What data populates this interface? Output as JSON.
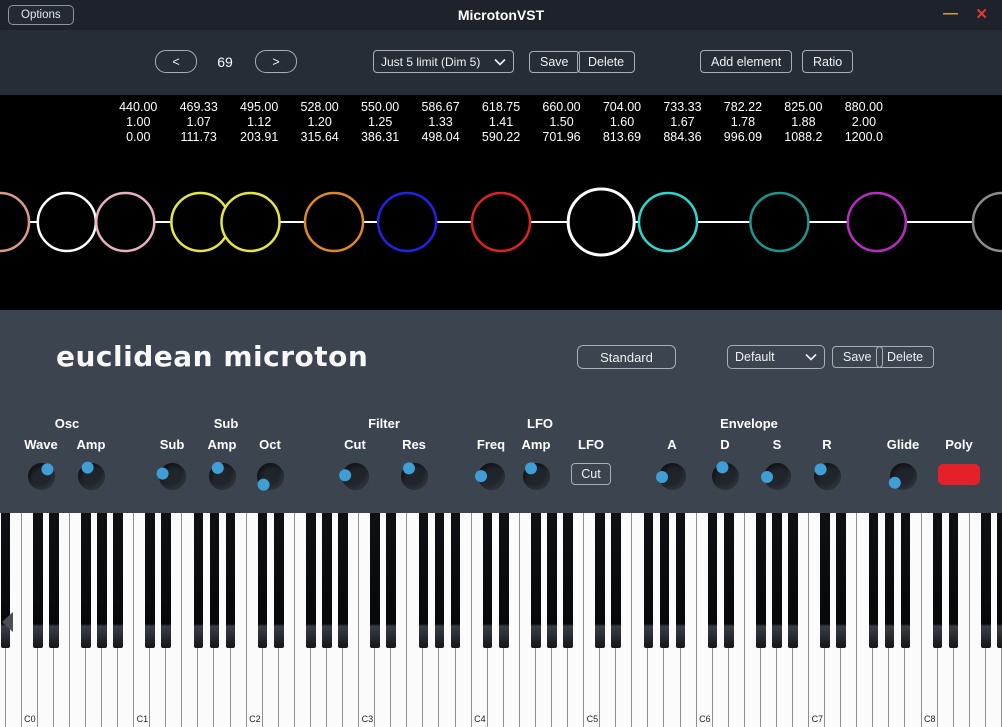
{
  "titlebar": {
    "options_label": "Options",
    "title": "MicrotonVST",
    "minimize_glyph": "—",
    "close_glyph": "✕"
  },
  "toolbar": {
    "prev_label": "<",
    "scale_number": "69",
    "next_label": ">",
    "scale_select_value": "Just 5 limit (Dim 5)",
    "save_label": "Save",
    "delete_label": "Delete",
    "add_element_label": "Add element",
    "ratio_label": "Ratio"
  },
  "scale_display": {
    "line_color": "#ffffff",
    "notes": [
      {
        "freq": "440.00",
        "ratio": "1.00",
        "cents": "0.00",
        "ratio_value": 1.0,
        "color": "#d99a8c",
        "selected": false
      },
      {
        "freq": "469.33",
        "ratio": "1.07",
        "cents": "111.73",
        "ratio_value": 1.0667,
        "color": "#ffffff",
        "selected": false
      },
      {
        "freq": "495.00",
        "ratio": "1.12",
        "cents": "203.91",
        "ratio_value": 1.125,
        "color": "#e8b0bc",
        "selected": false
      },
      {
        "freq": "528.00",
        "ratio": "1.20",
        "cents": "315.64",
        "ratio_value": 1.2,
        "color": "#e6e642",
        "selected": false
      },
      {
        "freq": "550.00",
        "ratio": "1.25",
        "cents": "386.31",
        "ratio_value": 1.25,
        "color": "#e6e642",
        "selected": false
      },
      {
        "freq": "586.67",
        "ratio": "1.33",
        "cents": "498.04",
        "ratio_value": 1.3333,
        "color": "#e08828",
        "selected": false
      },
      {
        "freq": "618.75",
        "ratio": "1.41",
        "cents": "590.22",
        "ratio_value": 1.4063,
        "color": "#2222e8",
        "selected": false
      },
      {
        "freq": "660.00",
        "ratio": "1.50",
        "cents": "701.96",
        "ratio_value": 1.5,
        "color": "#dd2222",
        "selected": false
      },
      {
        "freq": "704.00",
        "ratio": "1.60",
        "cents": "813.69",
        "ratio_value": 1.6,
        "color": "#ffffff",
        "selected": true
      },
      {
        "freq": "733.33",
        "ratio": "1.67",
        "cents": "884.36",
        "ratio_value": 1.6667,
        "color": "#2cd8d0",
        "selected": false
      },
      {
        "freq": "782.22",
        "ratio": "1.78",
        "cents": "996.09",
        "ratio_value": 1.7778,
        "color": "#1e948e",
        "selected": false
      },
      {
        "freq": "825.00",
        "ratio": "1.88",
        "cents": "1088.2",
        "ratio_value": 1.875,
        "color": "#b82cc4",
        "selected": false
      },
      {
        "freq": "880.00",
        "ratio": "2.00",
        "cents": "1200.0",
        "ratio_value": 2.0,
        "color": "#8c8c8c",
        "selected": false
      }
    ]
  },
  "synth": {
    "logo": "euclidean microton",
    "standard_label": "Standard",
    "preset_select_value": "Default",
    "save_label": "Save",
    "delete_label": "Delete",
    "knob_color": "#3f9fd4",
    "groups": [
      "Osc",
      "Sub",
      "Filter",
      "LFO",
      "Envelope"
    ],
    "controls": [
      {
        "label": "Wave",
        "type": "knob",
        "angle": 40
      },
      {
        "label": "Amp",
        "type": "knob",
        "angle": -20
      },
      {
        "label": "Sub",
        "type": "knob",
        "angle": -70
      },
      {
        "label": "Amp",
        "type": "knob",
        "angle": -25
      },
      {
        "label": "Oct",
        "type": "knob",
        "angle": -140
      },
      {
        "label": "Cut",
        "type": "knob",
        "angle": -80
      },
      {
        "label": "Res",
        "type": "knob",
        "angle": -30
      },
      {
        "label": "Freq",
        "type": "knob",
        "angle": -85
      },
      {
        "label": "Amp",
        "type": "knob",
        "angle": -30
      },
      {
        "label": "LFO",
        "type": "button",
        "button_label": "Cut"
      },
      {
        "label": "A",
        "type": "knob",
        "angle": -90
      },
      {
        "label": "D",
        "type": "knob",
        "angle": -15
      },
      {
        "label": "S",
        "type": "knob",
        "angle": -90
      },
      {
        "label": "R",
        "type": "knob",
        "angle": -40
      },
      {
        "label": "Glide",
        "type": "knob",
        "angle": -125
      },
      {
        "label": "Poly",
        "type": "led",
        "color": "#e42028"
      }
    ]
  },
  "keyboard": {
    "octave_labels": [
      "C0",
      "C1",
      "C2",
      "C3",
      "C4",
      "C5",
      "C6",
      "C7",
      "C8"
    ]
  }
}
